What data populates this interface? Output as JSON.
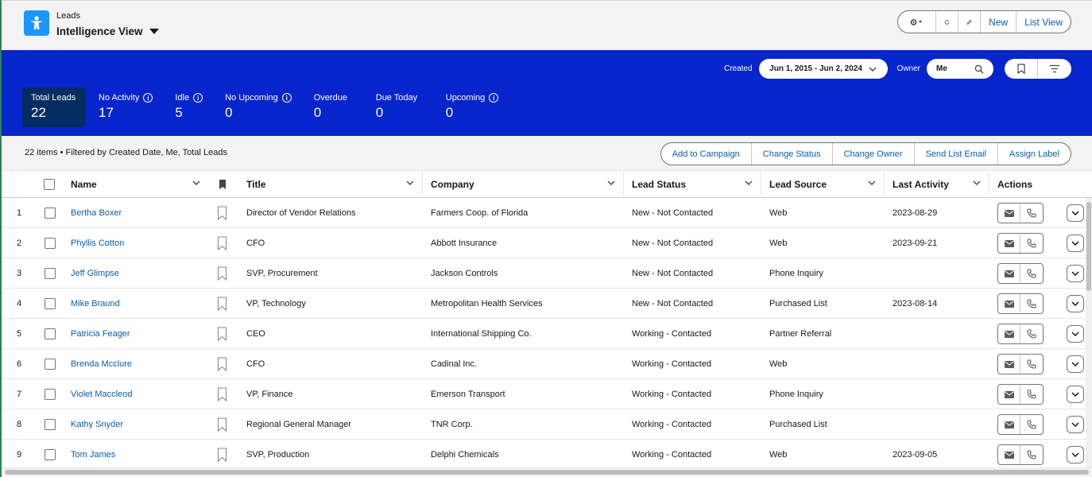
{
  "header": {
    "object_label": "Leads",
    "view_title": "Intelligence View",
    "buttons": {
      "new": "New",
      "list_view": "List View"
    }
  },
  "filters": {
    "created_label": "Created",
    "date_range": "Jun 1, 2015 - Jun 2, 2024",
    "owner_label": "Owner",
    "owner_value": "Me"
  },
  "metrics": [
    {
      "label": "Total Leads",
      "value": "22"
    },
    {
      "label": "No Activity",
      "value": "17"
    },
    {
      "label": "Idle",
      "value": "5"
    },
    {
      "label": "No Upcoming",
      "value": "0"
    },
    {
      "label": "Overdue",
      "value": "0"
    },
    {
      "label": "Due Today",
      "value": "0"
    },
    {
      "label": "Upcoming",
      "value": "0"
    }
  ],
  "toolbar": {
    "items_info": "22 items • Filtered by Created Date, Me, Total Leads",
    "add_to_campaign": "Add to Campaign",
    "change_status": "Change Status",
    "change_owner": "Change Owner",
    "send_list_email": "Send List Email",
    "assign_label": "Assign Label"
  },
  "columns": {
    "name": "Name",
    "title": "Title",
    "company": "Company",
    "lead_status": "Lead Status",
    "lead_source": "Lead Source",
    "last_activity": "Last Activity",
    "actions": "Actions"
  },
  "rows": [
    {
      "num": "1",
      "name": "Bertha Boxer",
      "title": "Director of Vendor Relations",
      "company": "Farmers Coop. of Florida",
      "status": "New - Not Contacted",
      "source": "Web",
      "last_activity": "2023-08-29"
    },
    {
      "num": "2",
      "name": "Phyllis Cotton",
      "title": "CFO",
      "company": "Abbott Insurance",
      "status": "New - Not Contacted",
      "source": "Web",
      "last_activity": "2023-09-21"
    },
    {
      "num": "3",
      "name": "Jeff Glimpse",
      "title": "SVP, Procurement",
      "company": "Jackson Controls",
      "status": "New - Not Contacted",
      "source": "Phone Inquiry",
      "last_activity": ""
    },
    {
      "num": "4",
      "name": "Mike Braund",
      "title": "VP, Technology",
      "company": "Metropolitan Health Services",
      "status": "New - Not Contacted",
      "source": "Purchased List",
      "last_activity": "2023-08-14"
    },
    {
      "num": "5",
      "name": "Patricia Feager",
      "title": "CEO",
      "company": "International Shipping Co.",
      "status": "Working - Contacted",
      "source": "Partner Referral",
      "last_activity": ""
    },
    {
      "num": "6",
      "name": "Brenda Mcclure",
      "title": "CFO",
      "company": "Cadinal Inc.",
      "status": "Working - Contacted",
      "source": "Web",
      "last_activity": ""
    },
    {
      "num": "7",
      "name": "Violet Maccleod",
      "title": "VP, Finance",
      "company": "Emerson Transport",
      "status": "Working - Contacted",
      "source": "Phone Inquiry",
      "last_activity": ""
    },
    {
      "num": "8",
      "name": "Kathy Snyder",
      "title": "Regional General Manager",
      "company": "TNR Corp.",
      "status": "Working - Contacted",
      "source": "Purchased List",
      "last_activity": ""
    },
    {
      "num": "9",
      "name": "Tom James",
      "title": "SVP, Production",
      "company": "Delphi Chemicals",
      "status": "Working - Contacted",
      "source": "Web",
      "last_activity": "2023-09-05"
    }
  ],
  "colors": {
    "band": "#0725cc",
    "active_metric": "#032d60",
    "link": "#0b5cab",
    "app_icon": "#1b96ff"
  }
}
